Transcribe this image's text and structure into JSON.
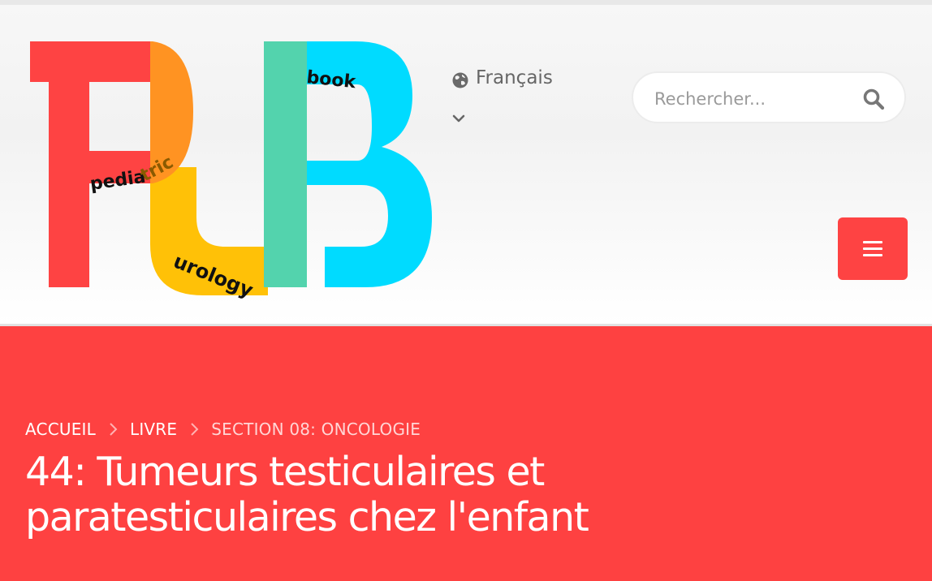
{
  "colors": {
    "accent_red": "#fe4343",
    "logo_orange": "#ff9322",
    "logo_yellow": "#ffc107",
    "logo_green": "#53d3ad",
    "logo_cyan": "#00dbff"
  },
  "logo": {
    "letters": "PUB",
    "word_pediatric_a": "pedia",
    "word_pediatric_b": "tric",
    "word_urology": "urology",
    "word_book": "book"
  },
  "language": {
    "label": "Français",
    "icon": "globe-icon",
    "chevron": "chevron-down-icon"
  },
  "search": {
    "placeholder": "Rechercher...",
    "icon": "search-icon"
  },
  "menu": {
    "icon": "hamburger-menu-icon"
  },
  "breadcrumb": {
    "items": [
      {
        "label": "ACCUEIL"
      },
      {
        "label": "LIVRE"
      },
      {
        "label": "SECTION 08: ONCOLOGIE"
      }
    ]
  },
  "page": {
    "title": "44: Tumeurs testiculaires et paratesticulaires chez l'enfant"
  }
}
